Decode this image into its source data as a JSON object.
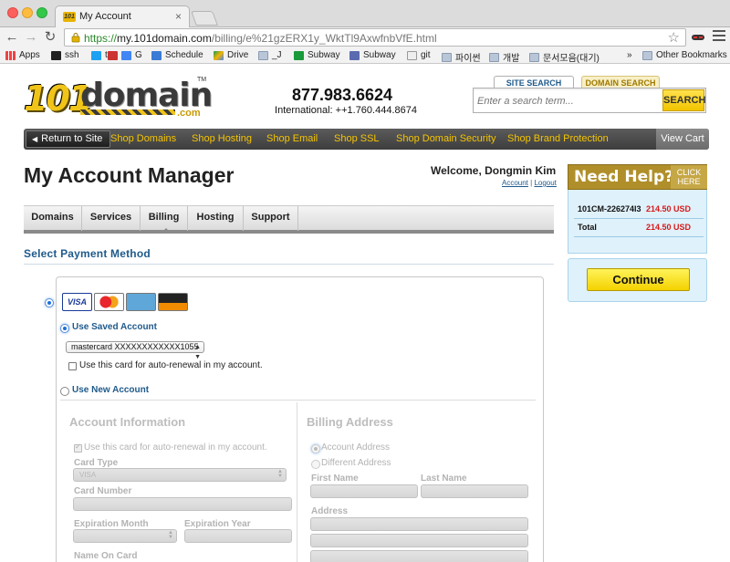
{
  "browser": {
    "tab_title": "My Account",
    "tab_favicon_text": "101",
    "url_scheme": "https://",
    "url_host": "my.101domain.com",
    "url_path": "/billing/e%21gzERX1y_WktTl9AxwfnbVfE.html",
    "bookmarks": [
      "Apps",
      "ssh",
      "t",
      "M",
      "G",
      "Schedule",
      "Drive",
      "_J",
      "Subway",
      "Subway",
      "git",
      "파이썬",
      "개발",
      "문서모음(대기)"
    ],
    "bookmarks_overflow": "»",
    "other_bookmarks": "Other Bookmarks"
  },
  "header": {
    "logo_101": "101",
    "logo_domain": "domain",
    "logo_com": ".com",
    "logo_tm": "TM",
    "phone": "877.983.6624",
    "phone_intl": "International: ++1.760.444.8674",
    "search_tab_site": "SITE SEARCH",
    "search_tab_domain": "DOMAIN SEARCH",
    "search_placeholder": "Enter a search term...",
    "search_button": "SEARCH"
  },
  "nav": {
    "return": "Return to Site",
    "links": [
      "Shop Domains",
      "Shop Hosting",
      "Shop Email",
      "Shop SSL",
      "Shop Domain Security",
      "Shop Brand Protection"
    ],
    "cart": "View Cart"
  },
  "account": {
    "title": "My Account Manager",
    "welcome": "Welcome, Dongmin Kim",
    "link_account": "Account",
    "link_sep": " | ",
    "link_logout": "Logout",
    "tabs": [
      "Domains",
      "Services",
      "Billing",
      "Hosting",
      "Support"
    ],
    "active_tab": "Billing"
  },
  "payment": {
    "section_title": "Select Payment Method",
    "card_logos": [
      "VISA",
      "MasterCard",
      "Amex",
      "DISCOVER NOVUS"
    ],
    "saved_label": "Use Saved Account",
    "saved_select_value": "mastercard XXXXXXXXXXXX1055",
    "autorenew_label": "Use this card for auto-renewal in my account.",
    "new_label": "Use New Account",
    "account_info": {
      "heading": "Account Information",
      "autorenew": "Use this card for auto-renewal in my account.",
      "card_type_label": "Card Type",
      "card_type_value": "VISA",
      "card_number_label": "Card Number",
      "exp_month_label": "Expiration Month",
      "exp_year_label": "Expiration Year",
      "name_label": "Name On Card"
    },
    "billing_address": {
      "heading": "Billing Address",
      "opt_account": "Account Address",
      "opt_different": "Different Address",
      "first_name_label": "First Name",
      "last_name_label": "Last Name",
      "address_label": "Address"
    }
  },
  "sidebar": {
    "help_text": "Need Help?",
    "help_click": "CLICK HERE",
    "order_id": "101CM-226274I3",
    "order_amount": "214.50 USD",
    "total_label": "Total",
    "total_amount": "214.50 USD",
    "continue": "Continue"
  },
  "colors": {
    "brand_gold": "#f0c419",
    "link_blue": "#1f5a8b",
    "price_red": "#d81a1a",
    "nav_dark": "#3d3d3d"
  }
}
